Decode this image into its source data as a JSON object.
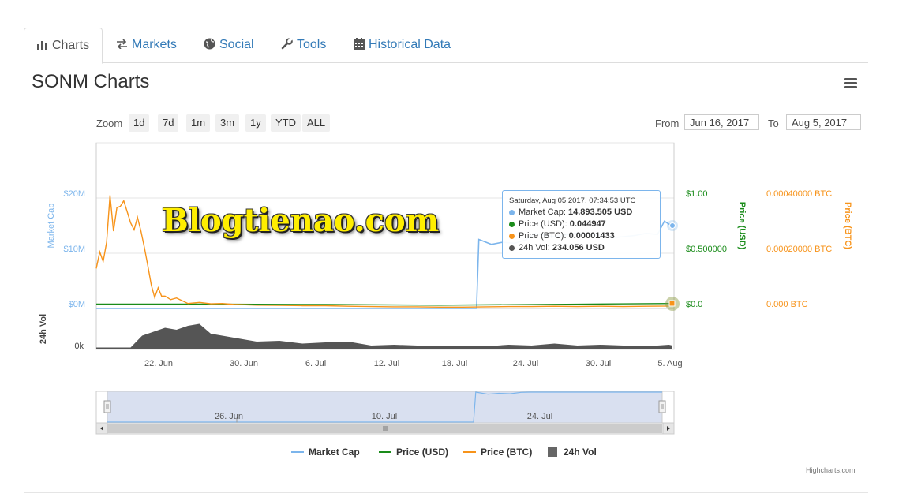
{
  "tabs": [
    {
      "label": "Charts",
      "icon": "bar-chart-icon"
    },
    {
      "label": "Markets",
      "icon": "exchange-icon"
    },
    {
      "label": "Social",
      "icon": "globe-icon"
    },
    {
      "label": "Tools",
      "icon": "wrench-icon"
    },
    {
      "label": "Historical Data",
      "icon": "calendar-icon"
    }
  ],
  "page_title": "SONM Charts",
  "zoom": {
    "label": "Zoom",
    "buttons": [
      "1d",
      "7d",
      "1m",
      "3m",
      "1y",
      "YTD",
      "ALL"
    ]
  },
  "range": {
    "from_label": "From",
    "from_value": "Jun 16, 2017",
    "to_label": "To",
    "to_value": "Aug 5, 2017"
  },
  "watermark": "Blogtienao.com",
  "tooltip": {
    "date": "Saturday, Aug 05 2017, 07:34:53 UTC",
    "rows": [
      {
        "label": "Market Cap",
        "value": "14.893.505 USD",
        "color": "#7cb5ec"
      },
      {
        "label": "Price (USD)",
        "value": "0.044947",
        "color": "#1a8c1a"
      },
      {
        "label": "Price (BTC)",
        "value": "0.00001433",
        "color": "#f7931a"
      },
      {
        "label": "24h Vol",
        "value": "234.056 USD",
        "color": "#555555"
      }
    ]
  },
  "legend": [
    {
      "label": "Market Cap",
      "color": "#7cb5ec"
    },
    {
      "label": "Price (USD)",
      "color": "#1a8c1a"
    },
    {
      "label": "Price (BTC)",
      "color": "#f7931a"
    },
    {
      "label": "24h Vol",
      "color": "#666666"
    }
  ],
  "credit": "Highcharts.com",
  "chart_data": {
    "type": "line",
    "x_tick_labels": [
      "22. Jun",
      "30. Jun",
      "6. Jul",
      "12. Jul",
      "18. Jul",
      "24. Jul",
      "30. Jul",
      "5. Aug"
    ],
    "navigator_tick_labels": [
      "26. Jun",
      "10. Jul",
      "24. Jul"
    ],
    "axes": {
      "market_cap": {
        "title": "Market Cap",
        "ticks": [
          "$20M",
          "$10M",
          "$0M"
        ],
        "color": "#7cb5ec"
      },
      "price_usd": {
        "title": "Price (USD)",
        "ticks": [
          "$1.00",
          "$0.500000",
          "$0.0"
        ],
        "color": "#1a8c1a"
      },
      "price_btc": {
        "title": "Price (BTC)",
        "ticks": [
          "0.00040000 BTC",
          "0.00020000 BTC",
          "0.000 BTC"
        ],
        "color": "#f7931a"
      },
      "volume": {
        "title": "24h Vol",
        "ticks": [
          "0k"
        ],
        "color": "#444444"
      }
    },
    "x_range_days": [
      0,
      50.3
    ],
    "market_cap_ylim": [
      0,
      20
    ],
    "price_btc_ylim": [
      0,
      0.0004
    ],
    "series": [
      {
        "name": "Market Cap",
        "unit": "$M",
        "x": [
          0,
          33.2,
          33.4,
          34.5,
          35.5,
          36.5,
          37.5,
          38.3,
          39.2,
          40,
          41,
          42,
          43,
          44,
          45,
          46,
          47,
          48,
          49,
          49.6,
          50.3
        ],
        "values": [
          0,
          0,
          12.5,
          11.6,
          12.0,
          11.8,
          12.4,
          13.6,
          13.2,
          13.0,
          13.3,
          13.7,
          13.5,
          13.1,
          12.8,
          13.0,
          13.2,
          13.6,
          13.4,
          15.8,
          14.89
        ]
      },
      {
        "name": "Price (BTC)",
        "unit": "BTC",
        "x": [
          0,
          0.3,
          0.6,
          0.9,
          1.2,
          1.5,
          1.8,
          2.1,
          2.4,
          2.7,
          3.0,
          3.3,
          3.6,
          3.9,
          4.2,
          4.5,
          4.8,
          5.1,
          5.4,
          5.7,
          6.0,
          6.5,
          7.0,
          8.0,
          9.0,
          10.0,
          11.0,
          12.0,
          14.0,
          16.0,
          18.0,
          20.0,
          22.0,
          24.0,
          26.0,
          28.0,
          30.0,
          32.0,
          34.0,
          36.0,
          38.0,
          40.0,
          42.0,
          44.0,
          46.0,
          48.0,
          50.0,
          50.3
        ],
        "values": [
          0.000145,
          0.000205,
          0.00017,
          0.00024,
          0.00041,
          0.00028,
          0.000365,
          0.00037,
          0.00039,
          0.00035,
          0.00031,
          0.000285,
          0.00033,
          0.00028,
          0.00022,
          0.000155,
          8.5e-05,
          4e-05,
          7.5e-05,
          4.5e-05,
          4.5e-05,
          3.2e-05,
          3.8e-05,
          1.8e-05,
          2.2e-05,
          1.7e-05,
          1.8e-05,
          1.5e-05,
          1.2e-05,
          1.1e-05,
          1e-05,
          1e-05,
          8e-06,
          7e-06,
          6e-06,
          6e-06,
          5e-06,
          5e-06,
          6e-06,
          7e-06,
          7e-06,
          8e-06,
          7e-06,
          8e-06,
          7e-06,
          8e-06,
          9e-06,
          1.43e-05
        ]
      },
      {
        "name": "Price (USD)",
        "unit": "$",
        "x": [
          0,
          10,
          20,
          30,
          40,
          50.3
        ],
        "values": [
          0.04,
          0.039,
          0.036,
          0.03,
          0.037,
          0.044947
        ]
      },
      {
        "name": "24h Vol",
        "unit": "relative",
        "x": [
          0,
          3,
          4,
          5,
          6,
          7,
          8,
          9,
          10,
          11,
          12,
          14,
          16,
          18,
          20,
          22,
          24,
          26,
          28,
          30,
          32,
          34,
          36,
          38,
          40,
          42,
          44,
          46,
          48,
          50,
          50.3
        ],
        "values": [
          0.05,
          0.05,
          0.35,
          0.45,
          0.55,
          0.5,
          0.6,
          0.65,
          0.4,
          0.35,
          0.3,
          0.2,
          0.22,
          0.15,
          0.18,
          0.2,
          0.1,
          0.12,
          0.1,
          0.08,
          0.1,
          0.08,
          0.12,
          0.1,
          0.15,
          0.1,
          0.12,
          0.1,
          0.08,
          0.12,
          0.1
        ]
      }
    ]
  }
}
